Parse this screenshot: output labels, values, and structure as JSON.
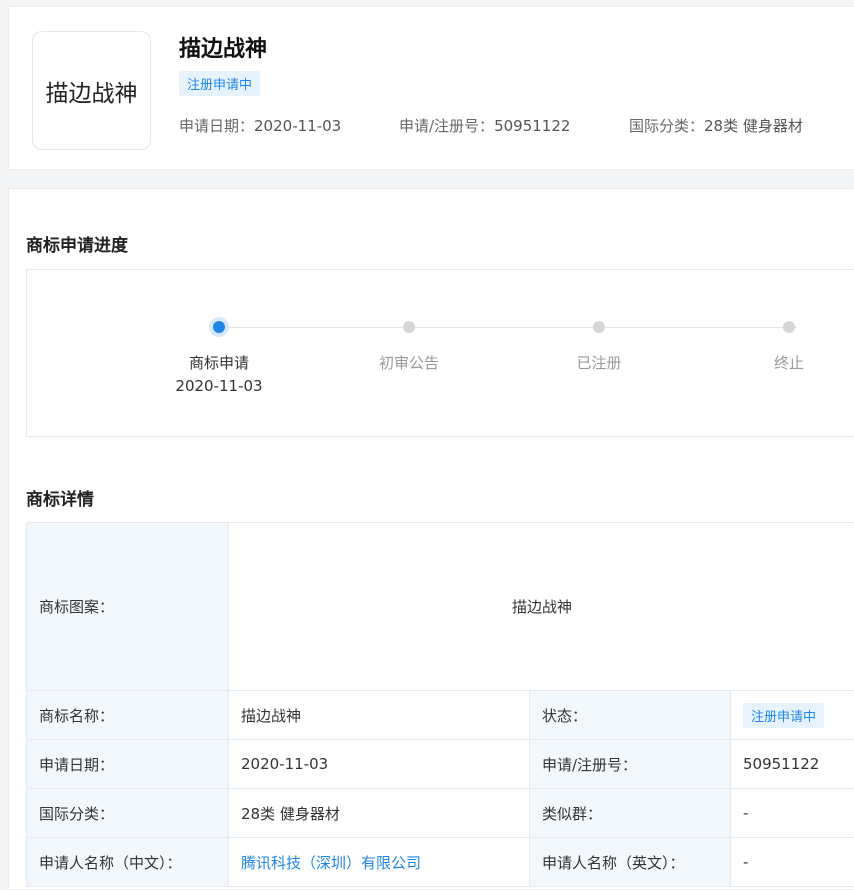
{
  "header": {
    "logo_text": "描边战神",
    "title": "描边战神",
    "status": "注册申请中",
    "meta": [
      {
        "label": "申请日期：",
        "value": "2020-11-03"
      },
      {
        "label": "申请/注册号：",
        "value": "50951122"
      },
      {
        "label": "国际分类：",
        "value": "28类 健身器材"
      }
    ]
  },
  "progress": {
    "title": "商标申请进度",
    "steps": [
      {
        "label": "商标申请",
        "date": "2020-11-03",
        "active": true
      },
      {
        "label": "初审公告",
        "date": "",
        "active": false
      },
      {
        "label": "已注册",
        "date": "",
        "active": false
      },
      {
        "label": "终止",
        "date": "",
        "active": false
      }
    ]
  },
  "details": {
    "title": "商标详情",
    "image_label": "商标图案：",
    "image_text": "描边战神",
    "rows": [
      {
        "l1": "商标名称：",
        "v1": "描边战神",
        "l2": "状态：",
        "v2": "注册申请中"
      },
      {
        "l1": "申请日期：",
        "v1": "2020-11-03",
        "l2": "申请/注册号：",
        "v2": "50951122"
      },
      {
        "l1": "国际分类：",
        "v1": "28类 健身器材",
        "l2": "类似群：",
        "v2": "-"
      },
      {
        "l1": "申请人名称（中文）：",
        "v1": "腾讯科技（深圳）有限公司",
        "l2": "申请人名称（英文）：",
        "v2": "-"
      }
    ]
  },
  "colors": {
    "accent": "#1f86e6",
    "tag_bg": "#e6f3fd",
    "label_bg": "#f2f7fb"
  }
}
